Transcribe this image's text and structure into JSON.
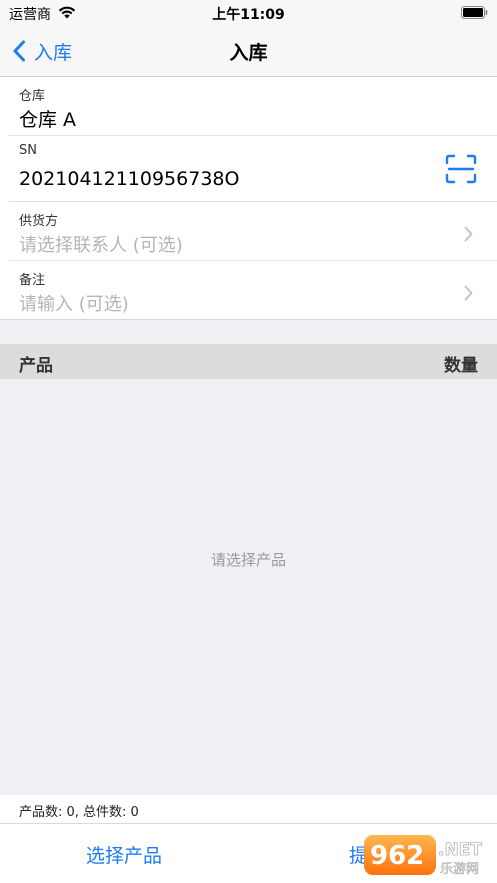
{
  "status_bar": {
    "carrier": "运营商",
    "time": "上午11:09"
  },
  "nav": {
    "back_label": "入库",
    "title": "入库"
  },
  "form": {
    "warehouse": {
      "label": "仓库",
      "value": "仓库 A"
    },
    "sn": {
      "label": "SN",
      "value": "20210412110956738O"
    },
    "supplier": {
      "label": "供货方",
      "placeholder": "请选择联系人 (可选)"
    },
    "note": {
      "label": "备注",
      "placeholder": "请输入 (可选)"
    }
  },
  "product_list": {
    "columns": [
      "产品",
      "数量"
    ],
    "empty_text": "请选择产品"
  },
  "summary": "产品数: 0, 总件数: 0",
  "bottom_bar": {
    "select_product": "选择产品",
    "submit": "提"
  },
  "watermark": {
    "text": "962.NET",
    "subtext": "乐游网"
  },
  "colors": {
    "accent": "#1e7cf2",
    "placeholder": "#b4b4b8",
    "list_header_bg": "#dcdcdc",
    "group_bg": "#efeff4"
  },
  "icons": {
    "wifi": "wifi-icon",
    "battery": "battery-icon",
    "back": "chevron-left-icon",
    "scan": "scan-icon",
    "disclosure": "chevron-right-icon"
  }
}
